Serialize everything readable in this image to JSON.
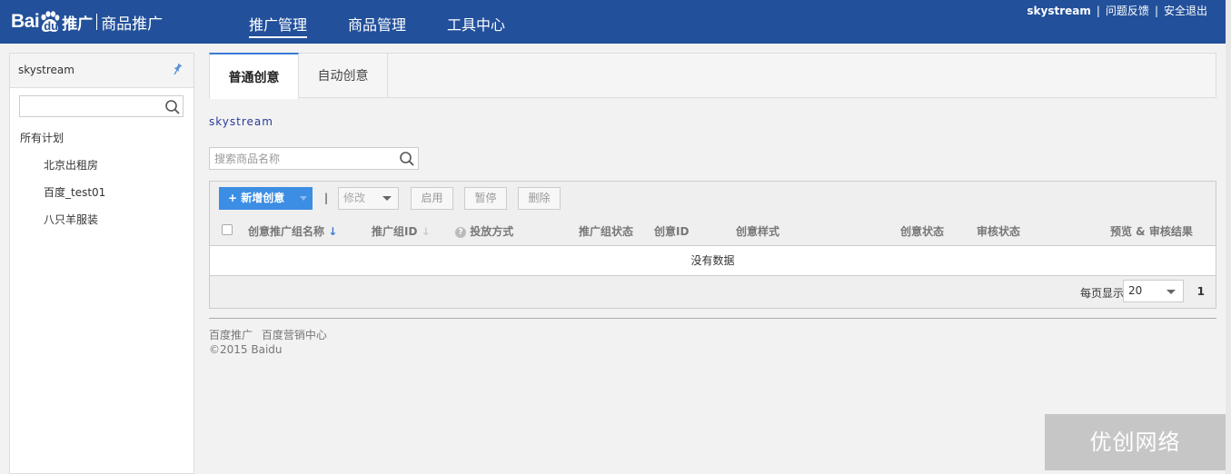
{
  "header": {
    "logo_text_bai": "Bai",
    "logo_text_du": "du",
    "logo_text_tg": "推广",
    "logo_product": "商品推广",
    "nav": [
      "推广管理",
      "商品管理",
      "工具中心"
    ],
    "user": "skystream",
    "feedback": "问题反馈",
    "logout": "安全退出",
    "pipe": "|"
  },
  "sidebar": {
    "account": "skystream",
    "root": "所有计划",
    "items": [
      "北京出租房",
      "百度_test01",
      "八只羊服装"
    ]
  },
  "main": {
    "tabs": [
      "普通创意",
      "自动创意"
    ],
    "breadcrumb": "skystream",
    "search_placeholder": "搜索商品名称",
    "toolbar": {
      "new": "+ 新增创意",
      "sep": "|",
      "edit": "修改",
      "enable": "启用",
      "pause": "暂停",
      "delete": "删除"
    },
    "columns": [
      "创意推广组名称",
      "推广组ID",
      "投放方式",
      "推广组状态",
      "创意ID",
      "创意样式",
      "创意状态",
      "审核状态",
      "预览 & 审核结果"
    ],
    "sort_arrow_active": "↓",
    "sort_arrow_inactive": "↓",
    "help_icon": "?",
    "empty_text": "没有数据",
    "pager": {
      "label": "每页显示",
      "page_size": "20",
      "page": "1"
    }
  },
  "footer": {
    "links": [
      "百度推广",
      "百度营销中心"
    ],
    "copyright": "©2015 Baidu"
  },
  "watermark": "优创网络",
  "colors": {
    "header_bg": "#22509b",
    "primary_button": "#3c8de4",
    "tab_active_border": "#3a7bd5",
    "breadcrumb": "#2a3b9a"
  }
}
